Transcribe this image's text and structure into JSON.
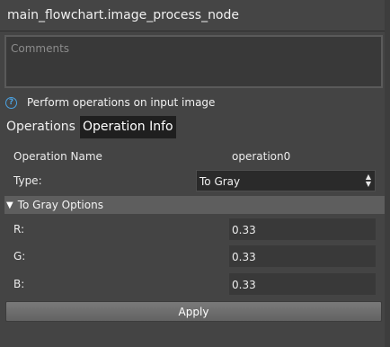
{
  "window": {
    "title": "main_flowchart.image_process_node"
  },
  "comments": {
    "placeholder": "Comments"
  },
  "help": {
    "icon": "help-circle-icon",
    "text": "Perform operations on input image"
  },
  "tabs": [
    {
      "label": "Operations",
      "active": false
    },
    {
      "label": "Operation Info",
      "active": true
    }
  ],
  "operation": {
    "name_label": "Operation Name",
    "name_value": "operation0",
    "type_label": "Type:",
    "type_value": "To Gray"
  },
  "options": {
    "title": "To Gray Options",
    "fields": [
      {
        "label": "R:",
        "value": "0.33"
      },
      {
        "label": "G:",
        "value": "0.33"
      },
      {
        "label": "B:",
        "value": "0.33"
      }
    ]
  },
  "apply_label": "Apply",
  "colors": {
    "background": "#444444",
    "accent": "#4ba3e3",
    "section": "#5e5e5e"
  }
}
